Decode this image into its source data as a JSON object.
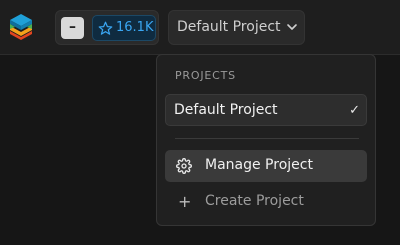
{
  "header": {
    "logo_icon": "stacked-layers-logo",
    "github": {
      "toggle_label": "–",
      "star_icon": "star-icon",
      "star_count": "16.1K",
      "accent_color": "#3aa6f2"
    },
    "project_selector": {
      "label": "Default Project",
      "icon": "chevron-down-icon"
    }
  },
  "dropdown": {
    "heading": "PROJECTS",
    "projects": [
      {
        "label": "Default Project",
        "selected": true,
        "check_icon": "checkmark-icon"
      }
    ],
    "actions": [
      {
        "label": "Manage Project",
        "icon": "gear-icon"
      },
      {
        "label": "Create Project",
        "icon": "plus-icon"
      }
    ]
  }
}
